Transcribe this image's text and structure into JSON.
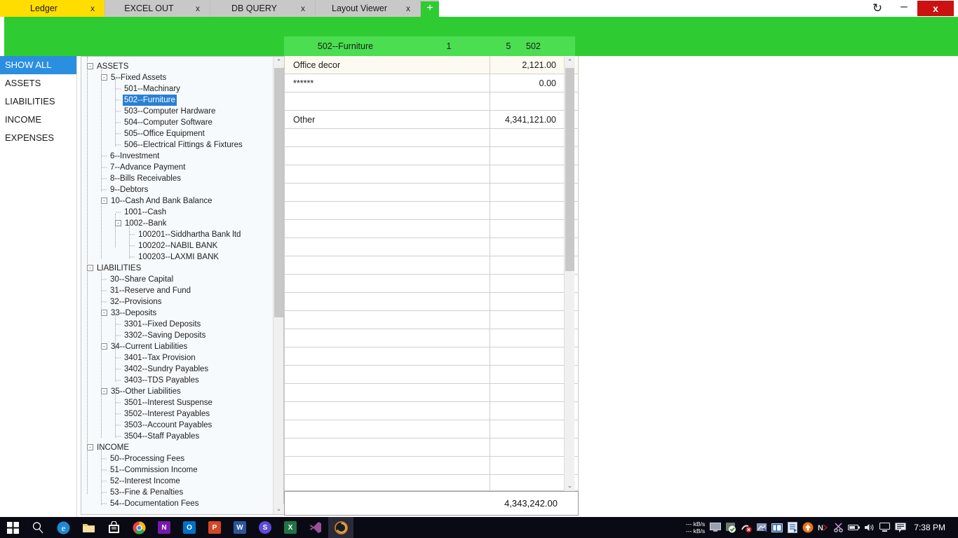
{
  "window": {
    "tabs": [
      {
        "label": "Ledger",
        "close": "x",
        "active": true
      },
      {
        "label": "EXCEL OUT",
        "close": "x",
        "active": false
      },
      {
        "label": "DB QUERY",
        "close": "x",
        "active": false
      },
      {
        "label": "Layout Viewer",
        "close": "x",
        "active": false
      }
    ],
    "add_tab_label": "+",
    "controls": {
      "refresh": "↻",
      "minimize": "–",
      "close": "x"
    },
    "active_tab_color": "#ffdd00",
    "band_color": "#2ecc32"
  },
  "categories": {
    "items": [
      {
        "label": "SHOW ALL",
        "selected": true
      },
      {
        "label": "ASSETS",
        "selected": false
      },
      {
        "label": "LIABILITIES",
        "selected": false
      },
      {
        "label": "INCOME",
        "selected": false
      },
      {
        "label": "EXPENSES",
        "selected": false
      }
    ],
    "selected_color": "#2a8fe0"
  },
  "tree": {
    "nodes": [
      {
        "label": "ASSETS",
        "indent": 0,
        "expander": "-",
        "selected": false
      },
      {
        "label": "5--Fixed Assets",
        "indent": 1,
        "expander": "-",
        "selected": false
      },
      {
        "label": "501--Machinary",
        "indent": 2,
        "expander": "",
        "selected": false
      },
      {
        "label": "502--Furniture",
        "indent": 2,
        "expander": "",
        "selected": true
      },
      {
        "label": "503--Computer Hardware",
        "indent": 2,
        "expander": "",
        "selected": false
      },
      {
        "label": "504--Computer Software",
        "indent": 2,
        "expander": "",
        "selected": false
      },
      {
        "label": "505--Office Equipment",
        "indent": 2,
        "expander": "",
        "selected": false
      },
      {
        "label": "506--Electrical Fittings & Fixtures",
        "indent": 2,
        "expander": "",
        "selected": false
      },
      {
        "label": "6--Investment",
        "indent": 1,
        "expander": "",
        "selected": false
      },
      {
        "label": "7--Advance Payment",
        "indent": 1,
        "expander": "",
        "selected": false
      },
      {
        "label": "8--Bills Receivables",
        "indent": 1,
        "expander": "",
        "selected": false
      },
      {
        "label": "9--Debtors",
        "indent": 1,
        "expander": "",
        "selected": false
      },
      {
        "label": "10--Cash And Bank Balance",
        "indent": 1,
        "expander": "-",
        "selected": false
      },
      {
        "label": "1001--Cash",
        "indent": 2,
        "expander": "",
        "selected": false
      },
      {
        "label": "1002--Bank",
        "indent": 2,
        "expander": "-",
        "selected": false
      },
      {
        "label": "100201--Siddhartha Bank ltd",
        "indent": 3,
        "expander": "",
        "selected": false
      },
      {
        "label": "100202--NABIL BANK",
        "indent": 3,
        "expander": "",
        "selected": false
      },
      {
        "label": "100203--LAXMI BANK",
        "indent": 3,
        "expander": "",
        "selected": false
      },
      {
        "label": "LIABILITIES",
        "indent": 0,
        "expander": "-",
        "selected": false
      },
      {
        "label": "30--Share Capital",
        "indent": 1,
        "expander": "",
        "selected": false
      },
      {
        "label": "31--Reserve and Fund",
        "indent": 1,
        "expander": "",
        "selected": false
      },
      {
        "label": "32--Provisions",
        "indent": 1,
        "expander": "",
        "selected": false
      },
      {
        "label": "33--Deposits",
        "indent": 1,
        "expander": "-",
        "selected": false
      },
      {
        "label": "3301--Fixed Deposits",
        "indent": 2,
        "expander": "",
        "selected": false
      },
      {
        "label": "3302--Saving Deposits",
        "indent": 2,
        "expander": "",
        "selected": false
      },
      {
        "label": "34--Current Liabilities",
        "indent": 1,
        "expander": "-",
        "selected": false
      },
      {
        "label": "3401--Tax Provision",
        "indent": 2,
        "expander": "",
        "selected": false
      },
      {
        "label": "3402--Sundry Payables",
        "indent": 2,
        "expander": "",
        "selected": false
      },
      {
        "label": "3403--TDS Payables",
        "indent": 2,
        "expander": "",
        "selected": false
      },
      {
        "label": "35--Other Liabilities",
        "indent": 1,
        "expander": "-",
        "selected": false
      },
      {
        "label": "3501--Interest Suspense",
        "indent": 2,
        "expander": "",
        "selected": false
      },
      {
        "label": "3502--Interest Payables",
        "indent": 2,
        "expander": "",
        "selected": false
      },
      {
        "label": "3503--Account Payables",
        "indent": 2,
        "expander": "",
        "selected": false
      },
      {
        "label": "3504--Staff Payables",
        "indent": 2,
        "expander": "",
        "selected": false
      },
      {
        "label": "INCOME",
        "indent": 0,
        "expander": "-",
        "selected": false
      },
      {
        "label": "50--Processing Fees",
        "indent": 1,
        "expander": "",
        "selected": false
      },
      {
        "label": "51--Commission Income",
        "indent": 1,
        "expander": "",
        "selected": false
      },
      {
        "label": "52--Interest Income",
        "indent": 1,
        "expander": "",
        "selected": false
      },
      {
        "label": "53--Fine & Penalties",
        "indent": 1,
        "expander": "",
        "selected": false
      },
      {
        "label": "54--Documentation Fees",
        "indent": 1,
        "expander": "",
        "selected": false
      }
    ],
    "selected_color": "#2a7fd4",
    "scroll_up": "⌃",
    "scroll_down": "⌄"
  },
  "grid": {
    "header": {
      "account": "502--Furniture",
      "col2": "1",
      "col3": "5",
      "col4": "502"
    },
    "rows": [
      {
        "name": "Office decor",
        "value": "2,121.00"
      },
      {
        "name": "******",
        "value": "0.00"
      },
      {
        "name": "",
        "value": ""
      },
      {
        "name": "Other",
        "value": "4,341,121.00"
      },
      {
        "name": "",
        "value": ""
      },
      {
        "name": "",
        "value": ""
      },
      {
        "name": "",
        "value": ""
      },
      {
        "name": "",
        "value": ""
      },
      {
        "name": "",
        "value": ""
      },
      {
        "name": "",
        "value": ""
      },
      {
        "name": "",
        "value": ""
      },
      {
        "name": "",
        "value": ""
      },
      {
        "name": "",
        "value": ""
      },
      {
        "name": "",
        "value": ""
      },
      {
        "name": "",
        "value": ""
      },
      {
        "name": "",
        "value": ""
      },
      {
        "name": "",
        "value": ""
      },
      {
        "name": "",
        "value": ""
      },
      {
        "name": "",
        "value": ""
      },
      {
        "name": "",
        "value": ""
      },
      {
        "name": "",
        "value": ""
      },
      {
        "name": "",
        "value": ""
      },
      {
        "name": "",
        "value": ""
      },
      {
        "name": "",
        "value": ""
      }
    ],
    "total": "4,343,242.00",
    "scroll_up": "⌃",
    "scroll_down": "⌄",
    "header_color": "#4ade50"
  },
  "taskbar": {
    "start": "start-icon",
    "apps": [
      {
        "name": "search-icon",
        "glyph": "⚲",
        "color": "#ffffff",
        "shape": "glyph"
      },
      {
        "name": "edge-icon",
        "glyph": "e",
        "color": "#1e8ad6",
        "shape": "glyph"
      },
      {
        "name": "file-explorer-icon",
        "glyph": "",
        "color": "#f2c14e",
        "shape": "folder"
      },
      {
        "name": "microsoft-store-icon",
        "glyph": "",
        "color": "#ffffff",
        "shape": "store"
      },
      {
        "name": "chrome-icon",
        "glyph": "",
        "color": "#dd4b39",
        "shape": "chrome"
      },
      {
        "name": "onenote-icon",
        "glyph": "N",
        "color": "#7719aa",
        "shape": "sq"
      },
      {
        "name": "outlook-icon",
        "glyph": "O",
        "color": "#0072c6",
        "shape": "sq"
      },
      {
        "name": "powerpoint-icon",
        "glyph": "P",
        "color": "#d24726",
        "shape": "sq"
      },
      {
        "name": "word-icon",
        "glyph": "W",
        "color": "#2b579a",
        "shape": "sq"
      },
      {
        "name": "skype-icon",
        "glyph": "S",
        "color": "#5b4bd6",
        "shape": "circ"
      },
      {
        "name": "excel-icon",
        "glyph": "X",
        "color": "#217346",
        "shape": "sq"
      },
      {
        "name": "visual-studio-icon",
        "glyph": "⨉",
        "color": "#9b4f96",
        "shape": "glyph"
      },
      {
        "name": "active-app-icon",
        "glyph": "◕",
        "color": "#d4892a",
        "shape": "circ",
        "active": true
      }
    ],
    "network_up": "--- kB/s",
    "network_down": "--- kB/s",
    "tray": [
      {
        "name": "monitor-icon",
        "glyph": "⬜"
      },
      {
        "name": "shield-check-icon",
        "glyph": "✓"
      },
      {
        "name": "blocked-icon",
        "glyph": "⊘"
      },
      {
        "name": "network-tool-icon",
        "glyph": "⌗"
      },
      {
        "name": "panel-icon",
        "glyph": "▥"
      },
      {
        "name": "document-icon",
        "glyph": "≡"
      },
      {
        "name": "update-arrow-icon",
        "glyph": "↑"
      },
      {
        "name": "nvidia-icon",
        "glyph": "N"
      },
      {
        "name": "snip-icon",
        "glyph": "✂"
      },
      {
        "name": "battery-icon",
        "glyph": "▭"
      },
      {
        "name": "volume-icon",
        "glyph": "ᴶ"
      },
      {
        "name": "network-icon",
        "glyph": "⎔"
      },
      {
        "name": "action-center-icon",
        "glyph": "▭"
      }
    ],
    "clock": "7:38 PM"
  }
}
